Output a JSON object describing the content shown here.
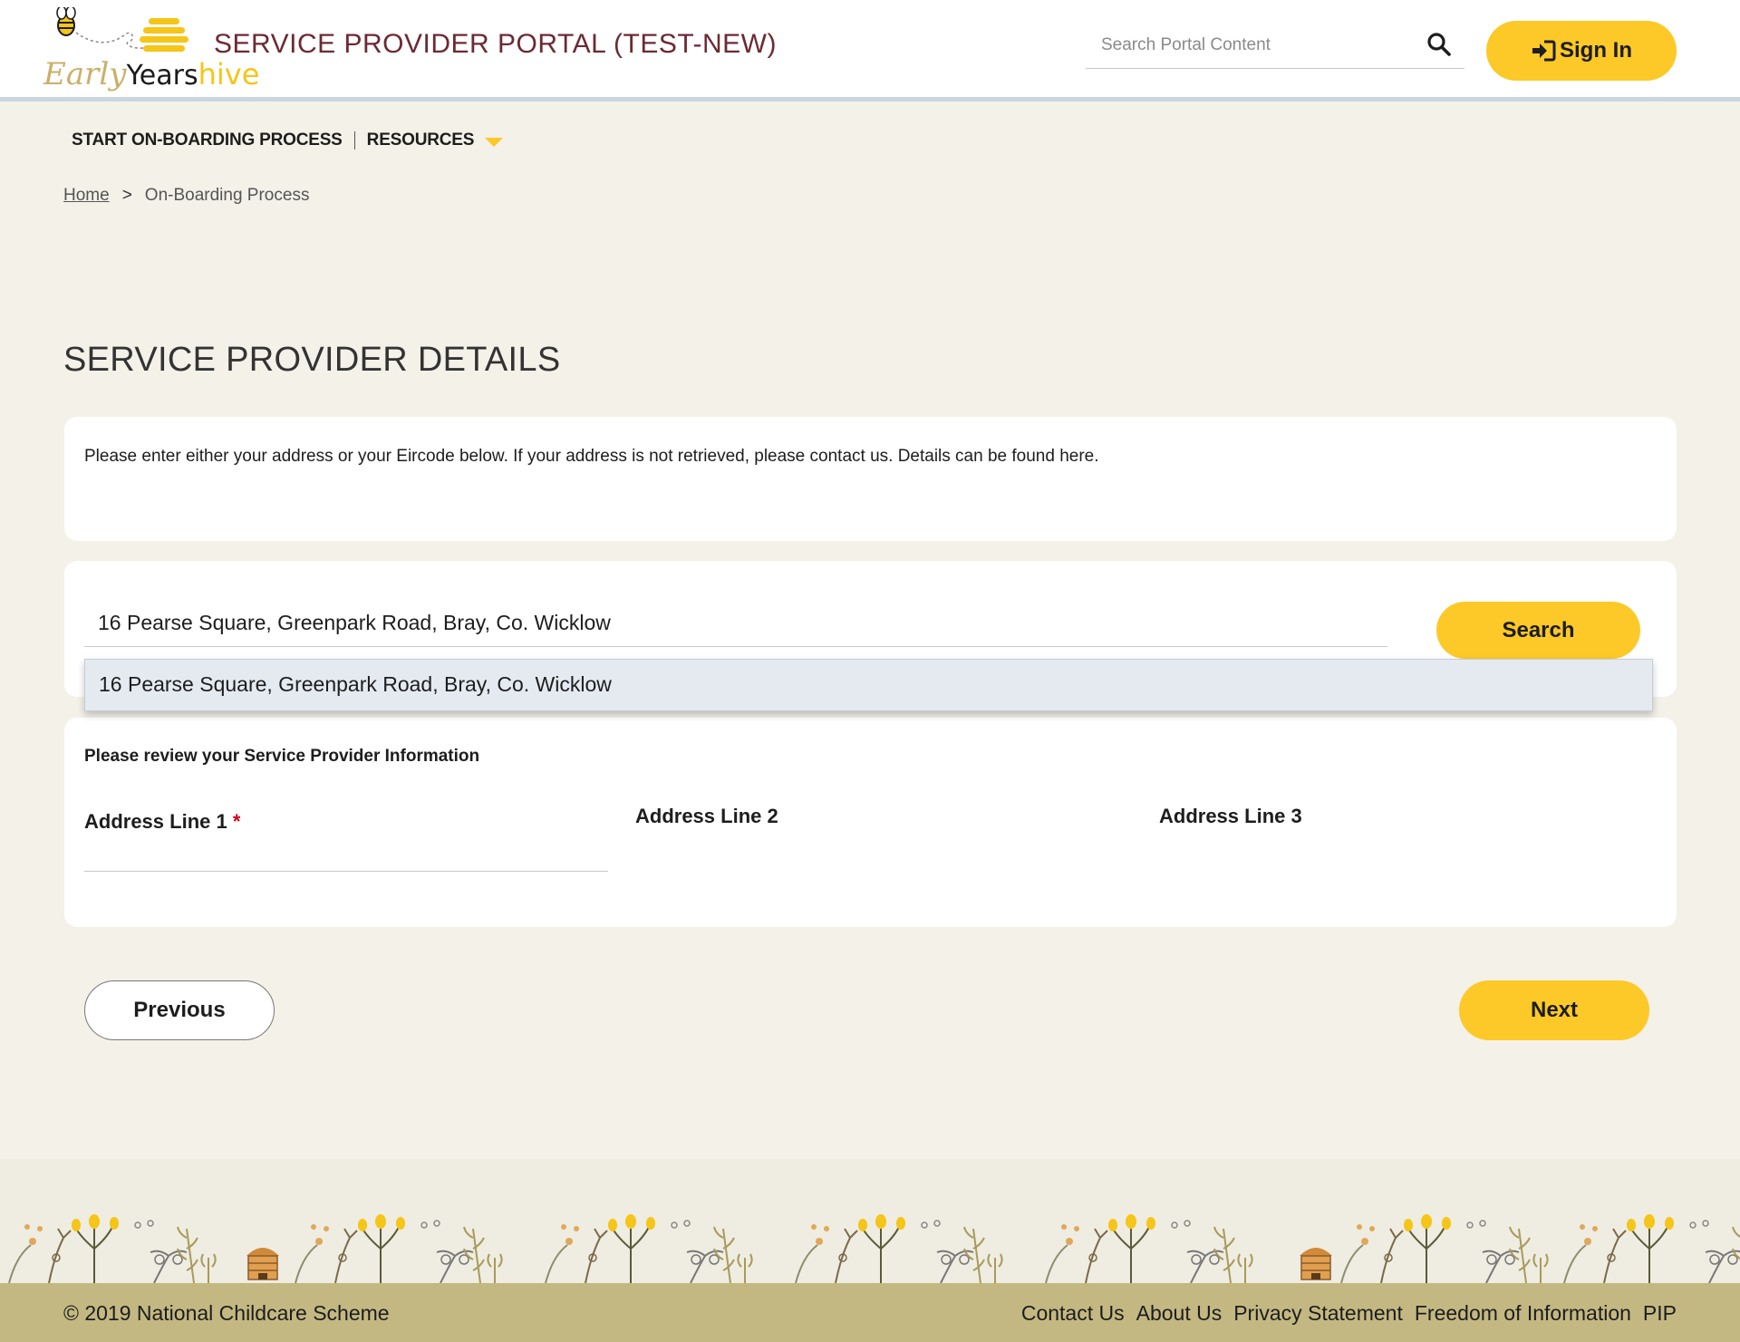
{
  "header": {
    "logo": {
      "early": "Early",
      "years": "Years",
      "hive": "hive"
    },
    "portal_title": "SERVICE PROVIDER PORTAL (TEST-NEW)",
    "search_placeholder": "Search Portal Content",
    "sign_in_label": "Sign In"
  },
  "nav": {
    "items": [
      {
        "label": "START ON-BOARDING PROCESS"
      },
      {
        "label": "RESOURCES"
      }
    ]
  },
  "breadcrumb": {
    "home": "Home",
    "separator": ">",
    "current": "On-Boarding Process"
  },
  "main": {
    "heading": "SERVICE PROVIDER DETAILS",
    "intro_text": "Please enter either your address or your Eircode below. If your address is not retrieved, please contact us. Details can be found here.",
    "address_search": {
      "value": "16 Pearse Square, Greenpark Road, Bray, Co. Wicklow",
      "search_label": "Search",
      "suggestions": [
        "16 Pearse Square, Greenpark Road, Bray, Co. Wicklow"
      ]
    },
    "review": {
      "title": "Please review your Service Provider Information",
      "address_line_1_label": "Address Line 1",
      "required_mark": "*",
      "address_line_2_label": "Address Line 2",
      "address_line_3_label": "Address Line 3",
      "address_line_1_value": ""
    },
    "previous_label": "Previous",
    "next_label": "Next"
  },
  "footer": {
    "copyright": "© 2019 National Childcare Scheme",
    "links": [
      "Contact Us",
      "About Us",
      "Privacy Statement",
      "Freedom of Information",
      "PIP"
    ]
  },
  "colors": {
    "accent_yellow": "#fcc928",
    "title_maroon": "#6b2a35",
    "page_bg": "#f3f1e8",
    "footer_bar": "#c4b882",
    "required_red": "#d0021b"
  }
}
